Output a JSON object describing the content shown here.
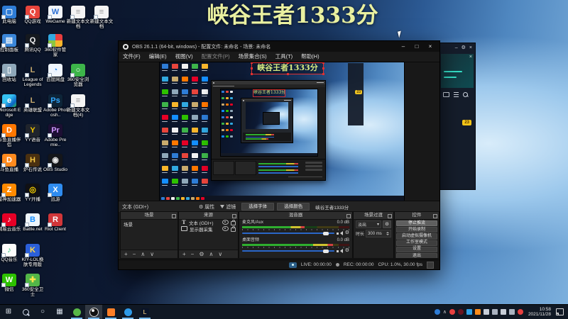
{
  "overlay_title": {
    "text": "峡谷王者1333分",
    "color": "#e9f0a0"
  },
  "desktop": {
    "icons": [
      {
        "label": "此电脑",
        "c": 0,
        "r": 0,
        "bg": "#2e7cd6",
        "g": "▢",
        "fg": "#eaf2fa"
      },
      {
        "label": "QQ游戏",
        "c": 1,
        "r": 0,
        "bg": "#e8453c",
        "g": "Q",
        "fg": "#ffffff"
      },
      {
        "label": "WeGame",
        "c": 2,
        "r": 0,
        "bg": "#f2f6fb",
        "g": "W",
        "fg": "#2b6fd4"
      },
      {
        "label": "新建文本文档",
        "c": 3,
        "r": 0,
        "bg": "#f4f4f4",
        "g": "≡",
        "fg": "#9a9a9a"
      },
      {
        "label": "新建文本文档",
        "c": 4,
        "r": 0,
        "bg": "#f4f4f4",
        "g": "≡",
        "fg": "#9a9a9a"
      },
      {
        "label": "控制面板",
        "c": 0,
        "r": 1,
        "bg": "#3b86d8",
        "g": "▤",
        "fg": "#eaf2fa"
      },
      {
        "label": "腾讯QQ",
        "c": 1,
        "r": 1,
        "bg": "#15191f",
        "g": "Q",
        "fg": "#f2f2f2"
      },
      {
        "label": "360软件管家",
        "c": 2,
        "r": 1,
        "bg": "conic-gradient(#e83e3e 0 25%,#f7b52c 0 50%,#8cc63f 0 75%,#31a8e0 0)",
        "g": "",
        "fg": "#ffffff"
      },
      {
        "label": "回收站",
        "c": 0,
        "r": 2,
        "bg": "#8fa8ba",
        "g": "▯",
        "fg": "#eef4f8"
      },
      {
        "label": "League of Legends",
        "c": 1,
        "r": 2,
        "bg": "#0a1428",
        "g": "L",
        "fg": "#c8aa6e"
      },
      {
        "label": "百度网盘",
        "c": 2,
        "r": 2,
        "bg": "#f0f6ff",
        "g": "◔",
        "fg": "#2f8cf0"
      },
      {
        "label": "360安全浏览器",
        "c": 3,
        "r": 2,
        "bg": "#3db54a",
        "g": "○",
        "fg": "#ffffff"
      },
      {
        "label": "Microsoft Edge",
        "c": 0,
        "r": 3,
        "bg": "linear-gradient(135deg,#35c1f1 0 40%,#0b62c4 75%,#2fc44f)",
        "g": "e",
        "fg": "#ffffff"
      },
      {
        "label": "英雄联盟",
        "c": 1,
        "r": 3,
        "bg": "#0a1428",
        "g": "L",
        "fg": "#c8aa6e"
      },
      {
        "label": "Adobe Photosh..",
        "c": 2,
        "r": 3,
        "bg": "#0d2438",
        "g": "Ps",
        "fg": "#31a8ff"
      },
      {
        "label": "新建文本文档(4)",
        "c": 3,
        "r": 3,
        "bg": "#f4f4f4",
        "g": "≡",
        "fg": "#9a9a9a"
      },
      {
        "label": "斗鱼直播伴侣",
        "c": 0,
        "r": 4,
        "bg": "#ff7700",
        "g": "D",
        "fg": "#ffffff"
      },
      {
        "label": "YY语音",
        "c": 1,
        "r": 4,
        "bg": "#20242c",
        "g": "Y",
        "fg": "#f2c600"
      },
      {
        "label": "Adobe Premie..",
        "c": 2,
        "r": 4,
        "bg": "#1c0f33",
        "g": "Pr",
        "fg": "#cf96ff"
      },
      {
        "label": "斗鱼直播",
        "c": 0,
        "r": 5,
        "bg": "#ff8a1e",
        "g": "D",
        "fg": "#ffffff"
      },
      {
        "label": "炉石传说",
        "c": 1,
        "r": 5,
        "bg": "#4a3010",
        "g": "H",
        "fg": "#f4c542"
      },
      {
        "label": "OBS Studio",
        "c": 2,
        "r": 5,
        "bg": "#14161a",
        "g": "◉",
        "fg": "#e8e8e8"
      },
      {
        "label": "雷神加速器",
        "c": 0,
        "r": 6,
        "bg": "#ff8a00",
        "g": "Z",
        "fg": "#ffffff"
      },
      {
        "label": "YY开播",
        "c": 1,
        "r": 6,
        "bg": "#101014",
        "g": "◎",
        "fg": "#ffd800"
      },
      {
        "label": "迅游",
        "c": 2,
        "r": 6,
        "bg": "#2f8cf0",
        "g": "X",
        "fg": "#ffffff"
      },
      {
        "label": "网易云音乐",
        "c": 0,
        "r": 7,
        "bg": "#e60026",
        "g": "♪",
        "fg": "#ffffff"
      },
      {
        "label": "Battle.net",
        "c": 1,
        "r": 7,
        "bg": "#eef4fa",
        "g": "B",
        "fg": "#148eff"
      },
      {
        "label": "Riot Client",
        "c": 2,
        "r": 7,
        "bg": "#d13639",
        "g": "R",
        "fg": "#ffffff"
      },
      {
        "label": "QQ音乐",
        "c": 0,
        "r": 8,
        "bg": "#fdfdfd",
        "g": "♪",
        "fg": "#31c27c"
      },
      {
        "label": "KIY-LOL换肤专用版",
        "c": 1,
        "r": 8,
        "bg": "#2b5fd9",
        "g": "K",
        "fg": "#ffd84a"
      },
      {
        "label": "微信",
        "c": 0,
        "r": 9,
        "bg": "#2dc100",
        "g": "W",
        "fg": "#ffffff"
      },
      {
        "label": "360安全卫士",
        "c": 1,
        "r": 9,
        "bg": "#52b648",
        "g": "✚",
        "fg": "#ffe44a"
      }
    ],
    "right_panel": {
      "badge": "23",
      "controls": {
        "min": "–",
        "gear": "⚙",
        "close": "×"
      }
    }
  },
  "obs": {
    "titlebar": {
      "title": "OBS 26.1.1 (64-bit, windows) - 配置文件: 未命名 - 场景: 未命名",
      "window_controls": {
        "min": "–",
        "max": "□",
        "close": "×"
      }
    },
    "menus": [
      {
        "label": "文件(F)"
      },
      {
        "label": "编辑(E)"
      },
      {
        "label": "视图(V)"
      },
      {
        "label": "配置文件(P)",
        "dim": true
      },
      {
        "label": "场景集合(S)"
      },
      {
        "label": "工具(T)"
      },
      {
        "label": "帮助(H)"
      }
    ],
    "preview": {
      "selected_text": "峡谷王者1333分",
      "icon_colors": [
        "#2e7cd6",
        "#e8453c",
        "#f2f2f2",
        "#3db54a",
        "#f7b52c",
        "#31a8e0",
        "#c8aa6e",
        "#ff7700",
        "#e60026",
        "#148eff",
        "#2dc100",
        "#8fa8ba"
      ]
    },
    "toolbar": {
      "source_label": "文本 (GDI+)",
      "gear": "⚙",
      "properties_label": "属性",
      "filters_label": "滤镜",
      "select_font": "选择字体",
      "select_color": "选择颜色",
      "text_value": "峡谷王者1333分"
    },
    "panel_toolbar": {
      "add": "+",
      "remove": "−",
      "up": "∧",
      "down": "∨",
      "gear": "⚙"
    },
    "scenes": {
      "title": "场景",
      "items": [
        "场景"
      ]
    },
    "sources": {
      "title": "来源",
      "items": [
        {
          "icon": "text",
          "label": "文本 (GDI+)"
        },
        {
          "icon": "display",
          "label": "显示器采集"
        }
      ]
    },
    "mixer": {
      "title": "混音器",
      "channels": [
        {
          "name": "麦克风/Aux",
          "db": "0.0 dB",
          "level": 0.58
        },
        {
          "name": "桌面音频",
          "db": "0.0 dB",
          "level": 0.85
        }
      ]
    },
    "transitions": {
      "title": "场景过渡",
      "value": "淡出",
      "caret": "▾",
      "duration_label": "时长",
      "duration": "300 ms"
    },
    "controls": {
      "title": "控件",
      "buttons": [
        {
          "label": "停止推流",
          "active": true
        },
        {
          "label": "开始录制"
        },
        {
          "label": "启动虚拟摄像机"
        },
        {
          "label": "工作室模式"
        },
        {
          "label": "设置"
        },
        {
          "label": "退出"
        }
      ]
    },
    "status": {
      "live_label": "LIVE: 00:00:00",
      "rec_label": "REC: 00:00:00",
      "cpu_label": "CPU: 1.0%, 30.00 fps"
    }
  },
  "taskbar": {
    "apps": [
      {
        "name": "start-button",
        "kind": "glyph",
        "g": "⊞",
        "fg": "#e8eef5"
      },
      {
        "name": "search-button",
        "kind": "search"
      },
      {
        "name": "cortana-button",
        "kind": "glyph",
        "g": "○",
        "fg": "#d8e0ea"
      },
      {
        "name": "task-view-button",
        "kind": "glyph",
        "g": "▦",
        "fg": "#d8e0ea"
      },
      {
        "name": "app-360",
        "kind": "dot",
        "color": "#58b848",
        "underline": true
      },
      {
        "name": "app-obs-studio",
        "kind": "obs",
        "active": true,
        "underline": true
      },
      {
        "name": "app-wegame",
        "kind": "sq",
        "color": "#ff7f27",
        "underline": true
      },
      {
        "name": "app-douyu",
        "kind": "dot",
        "color": "#2e9ae8",
        "underline": true
      },
      {
        "name": "app-league-of-legends",
        "kind": "lol",
        "underline": true
      }
    ],
    "tray": [
      {
        "name": "edge-tray-icon",
        "kind": "dot",
        "color": "#2e7cd6"
      },
      {
        "name": "tray-expand-arrow",
        "kind": "glyph",
        "g": "∧"
      },
      {
        "name": "tray-icon-red",
        "kind": "dot",
        "color": "#e84040"
      },
      {
        "name": "tray-icon-darkred",
        "kind": "dot",
        "color": "#6b1420"
      },
      {
        "name": "tray-icon-blue-sq",
        "kind": "sq",
        "color": "#2ea0e8"
      },
      {
        "name": "tray-icon-orange",
        "kind": "sq",
        "color": "#ff8c1a"
      },
      {
        "name": "microphone-tray-icon",
        "kind": "sq",
        "color": "#c8ced8"
      },
      {
        "name": "display-tray-icon",
        "kind": "sq",
        "color": "#aab2c0"
      },
      {
        "name": "volume-tray-icon",
        "kind": "sq",
        "color": "#c8ced8"
      },
      {
        "name": "network-tray-icon",
        "kind": "sq",
        "color": "#aab2c0"
      },
      {
        "name": "tray-icon-red2",
        "kind": "dot",
        "color": "#e84040"
      }
    ],
    "clock": {
      "time": "10:58",
      "date": "2021/11/28"
    }
  }
}
